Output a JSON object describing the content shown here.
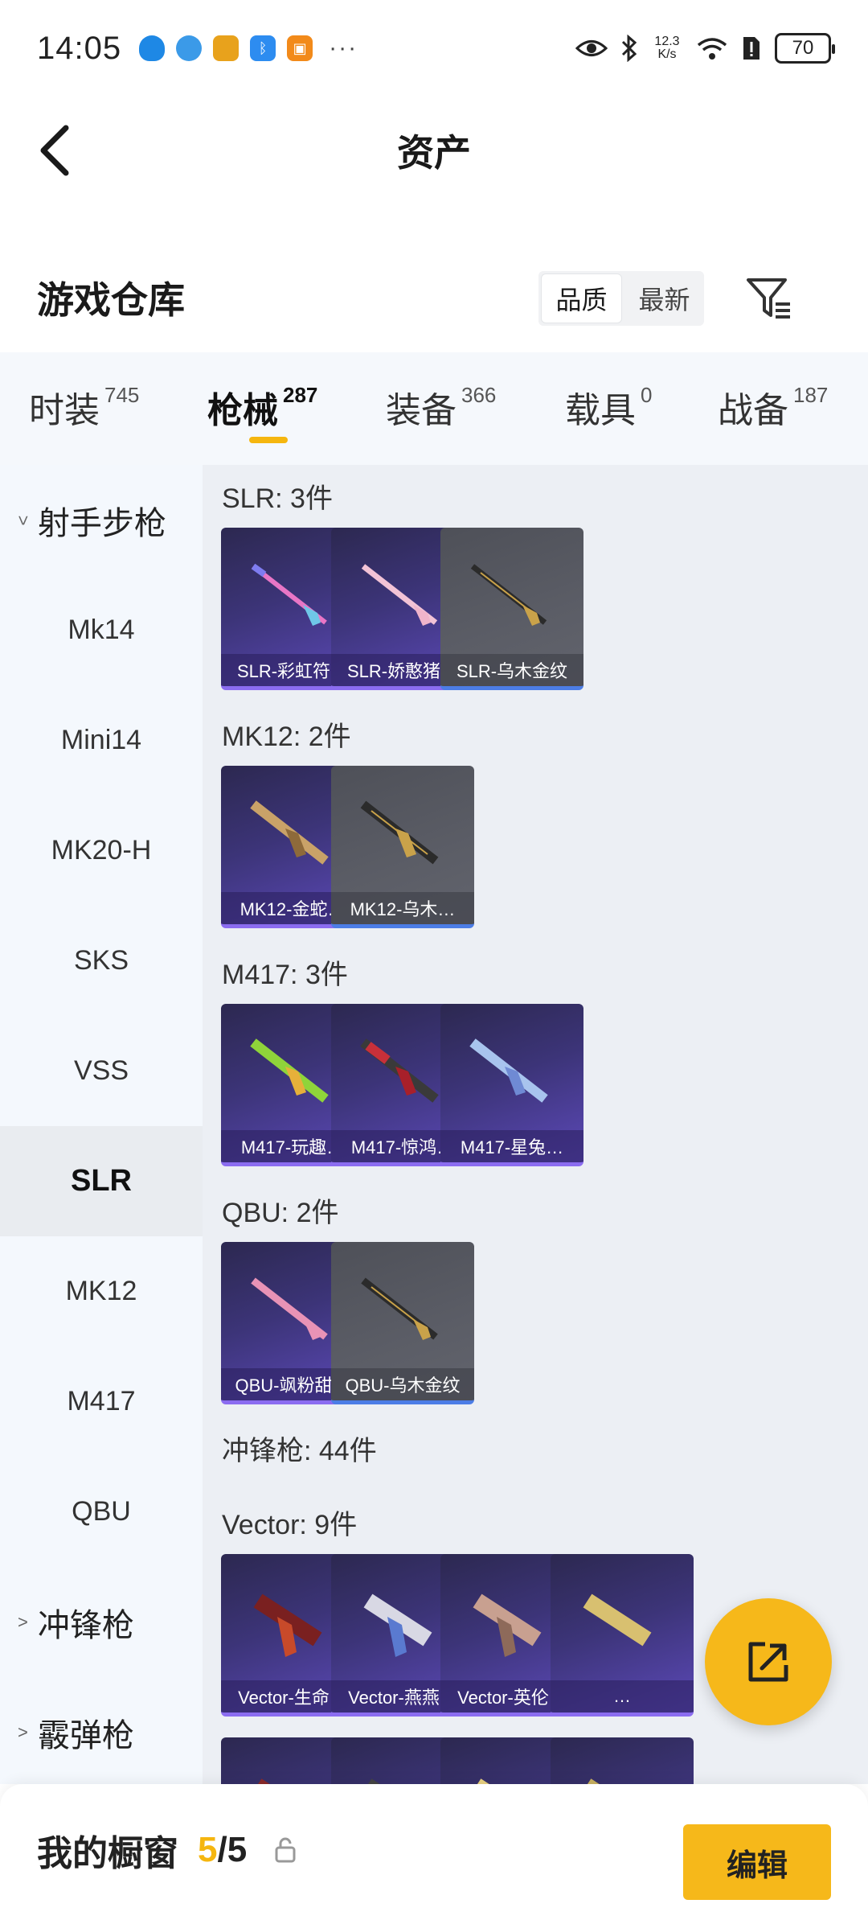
{
  "status_bar": {
    "time": "14:05",
    "net_speed_value": "12.3",
    "net_speed_unit": "K/s",
    "battery": "70",
    "more": "···"
  },
  "header": {
    "title": "资产"
  },
  "section": {
    "title": "游戏仓库",
    "sort_quality": "品质",
    "sort_newest": "最新"
  },
  "tabs": [
    {
      "label": "时装",
      "count": "745"
    },
    {
      "label": "枪械",
      "count": "287"
    },
    {
      "label": "装备",
      "count": "366"
    },
    {
      "label": "载具",
      "count": "0"
    },
    {
      "label": "战备",
      "count": "187"
    }
  ],
  "sidebar": {
    "group1": "射手步枪",
    "items": [
      "Mk14",
      "Mini14",
      "MK20-H",
      "SKS",
      "VSS",
      "SLR",
      "MK12",
      "M417",
      "QBU"
    ],
    "group2": "冲锋枪",
    "group3": "霰弹枪"
  },
  "groups": [
    {
      "label": "SLR: 3件",
      "cards": [
        "SLR-彩虹符号",
        "SLR-娇憨猪猪",
        "SLR-乌木金纹"
      ]
    },
    {
      "label": "MK12: 2件",
      "cards": [
        "MK12-金蛇…",
        "MK12-乌木…"
      ]
    },
    {
      "label": "M417: 3件",
      "cards": [
        "M417-玩趣…",
        "M417-惊鸿…",
        "M417-星兔…"
      ]
    },
    {
      "label": "QBU: 2件",
      "cards": [
        "QBU-飒粉甜心",
        "QBU-乌木金纹"
      ]
    },
    {
      "label": "冲锋枪: 44件",
      "cards": []
    },
    {
      "label": "Vector: 9件",
      "cards": [
        "Vector-生命…",
        "Vector-燕燕…",
        "Vector-英伦…",
        "…"
      ]
    }
  ],
  "bottom_bar": {
    "title": "我的橱窗",
    "current": "5",
    "total": "/5",
    "edit": "编辑"
  },
  "colors": {
    "accent": "#f6b81a",
    "rare_card": "#3c3478",
    "common_card": "#5b5d66"
  }
}
